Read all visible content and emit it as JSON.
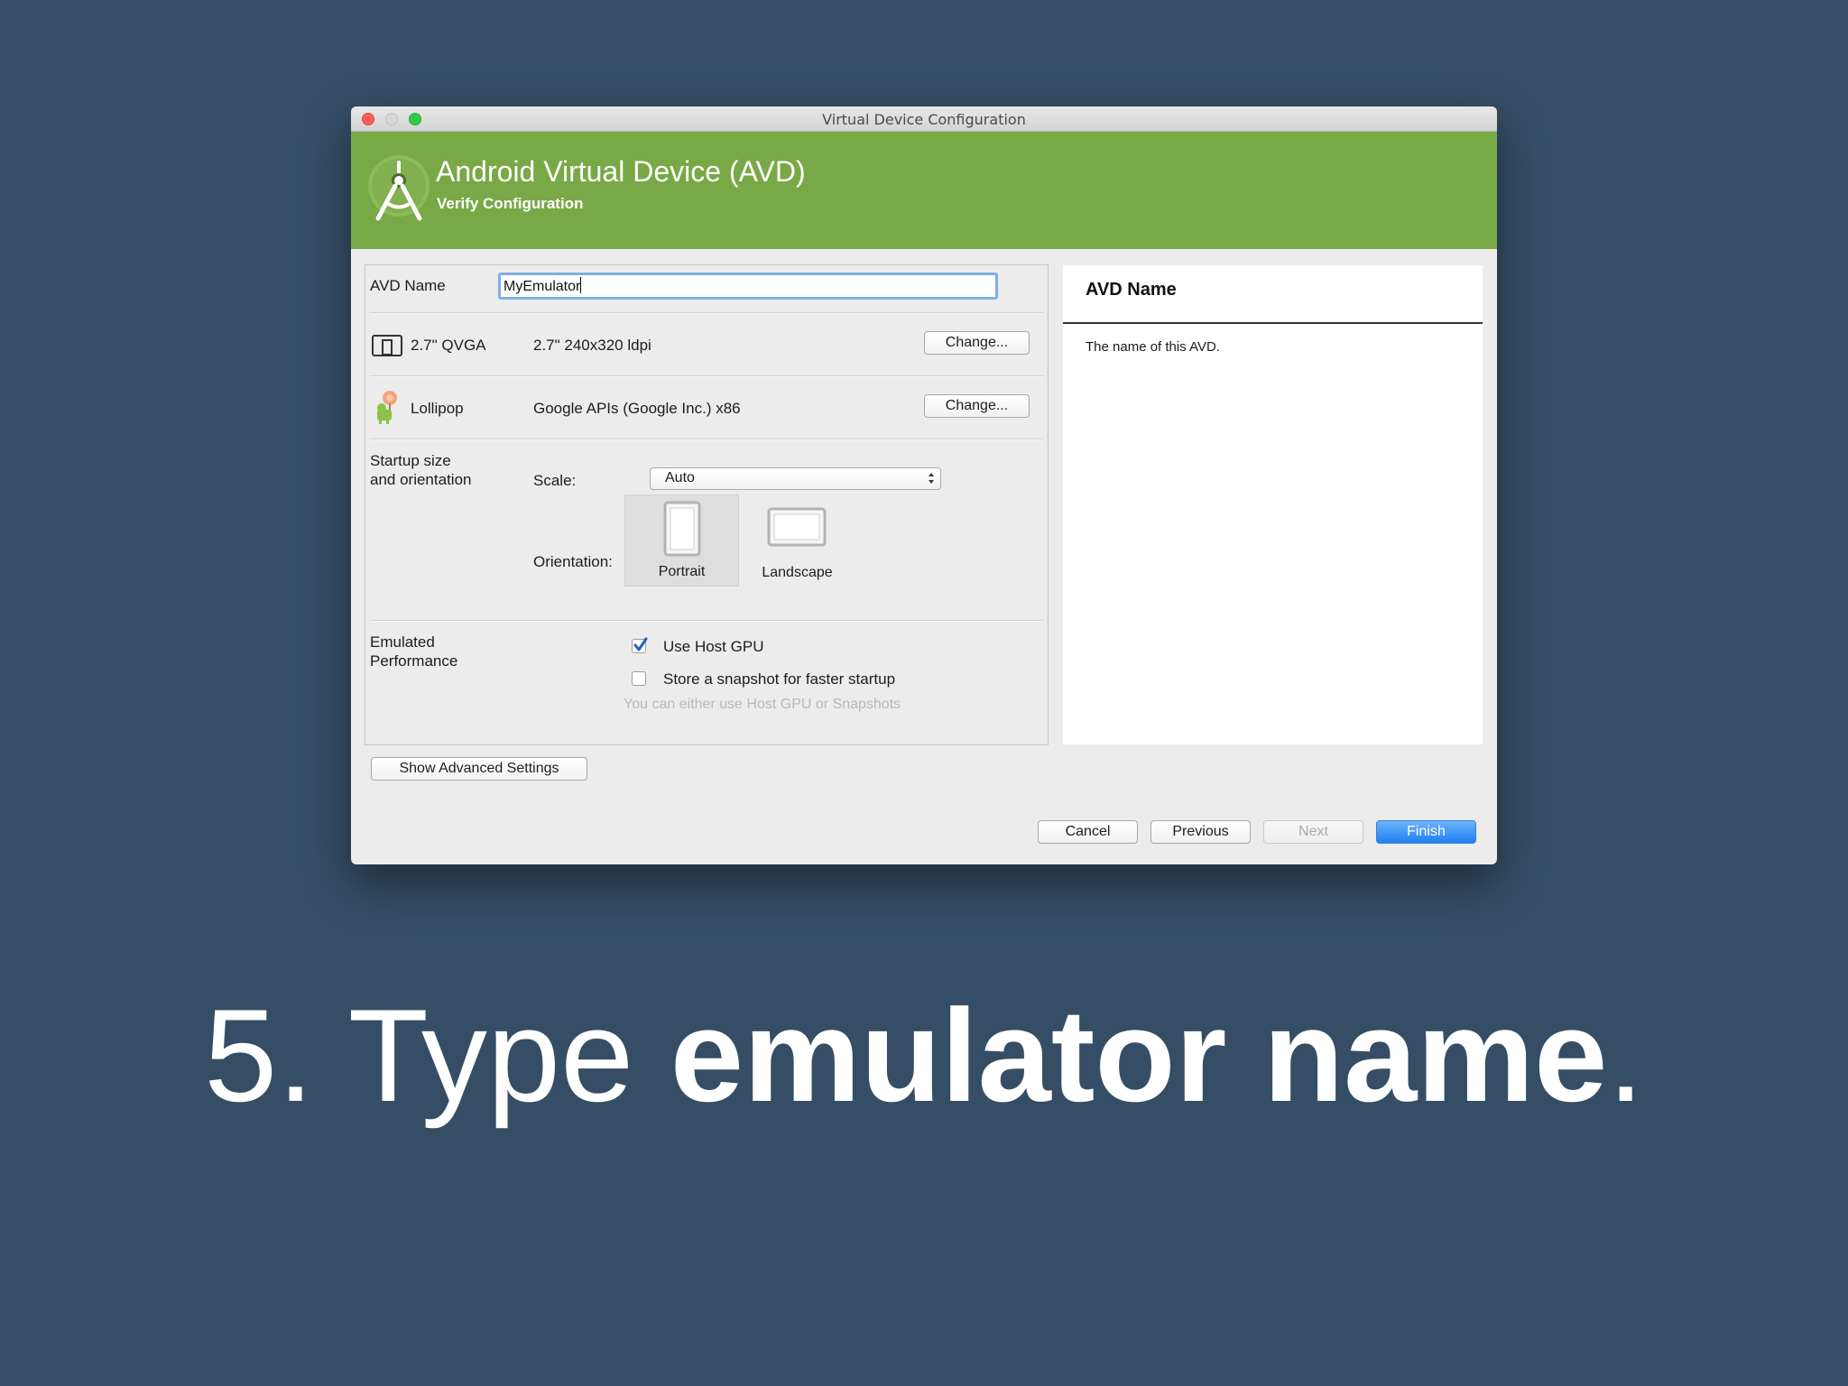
{
  "window": {
    "title": "Virtual Device Configuration"
  },
  "banner": {
    "title": "Android Virtual Device (AVD)",
    "subtitle": "Verify Configuration",
    "logo_icon": "android-studio-icon",
    "color": "#79a847"
  },
  "form": {
    "avd_name_label": "AVD Name",
    "avd_name_value": "MyEmulator",
    "device": {
      "icon": "phone-device-icon",
      "name": "2.7\" QVGA",
      "spec": "2.7\" 240x320 ldpi",
      "change_label": "Change..."
    },
    "system_image": {
      "icon": "lollipop-icon",
      "name": "Lollipop",
      "spec": "Google APIs (Google Inc.) x86",
      "change_label": "Change..."
    },
    "startup": {
      "section_label": "Startup size and orientation",
      "scale_label": "Scale:",
      "scale_value": "Auto",
      "orientation_label": "Orientation:",
      "portrait_label": "Portrait",
      "landscape_label": "Landscape",
      "selected_orientation": "Portrait"
    },
    "performance": {
      "section_label": "Emulated Performance",
      "host_gpu_label": "Use Host GPU",
      "host_gpu_checked": true,
      "snapshot_label": "Store a snapshot for faster startup",
      "snapshot_checked": false,
      "hint": "You can either use Host GPU or Snapshots"
    },
    "advanced_button": "Show Advanced Settings"
  },
  "help": {
    "title": "AVD Name",
    "text": "The name of this AVD."
  },
  "footer": {
    "cancel": "Cancel",
    "previous": "Previous",
    "next": "Next",
    "finish": "Finish"
  },
  "caption": {
    "prefix": "5. Type ",
    "emphasis": "emulator name",
    "suffix": "."
  },
  "colors": {
    "background": "#354e66",
    "accent": "#79a847",
    "primary_button": "#1f7ff2",
    "focus_ring": "#7faee8"
  }
}
